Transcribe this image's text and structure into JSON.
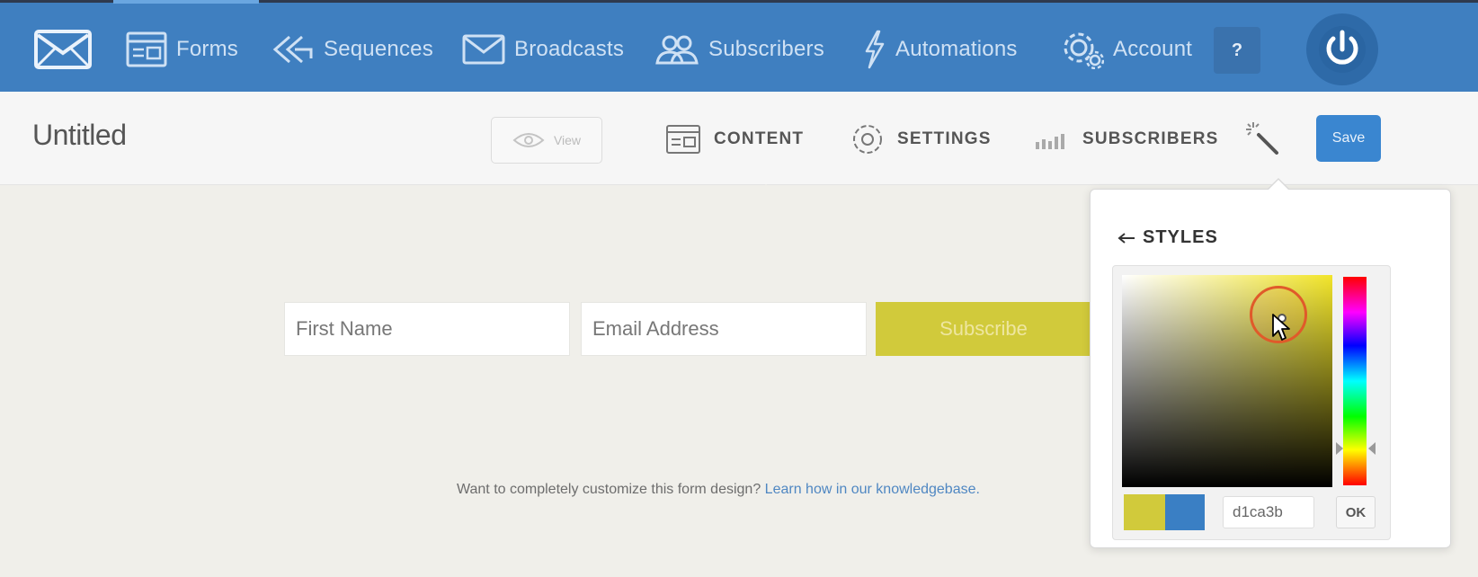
{
  "nav": {
    "items": [
      {
        "label": "Forms",
        "icon": "forms-icon"
      },
      {
        "label": "Sequences",
        "icon": "sequences-icon"
      },
      {
        "label": "Broadcasts",
        "icon": "envelope-icon"
      },
      {
        "label": "Subscribers",
        "icon": "users-icon"
      },
      {
        "label": "Automations",
        "icon": "lightning-icon"
      },
      {
        "label": "Account",
        "icon": "gear-icon"
      }
    ],
    "help_label": "?",
    "brand_color": "#3f7fc0"
  },
  "subbar": {
    "title": "Untitled",
    "view_label": "View",
    "tabs": [
      {
        "label": "CONTENT",
        "icon": "content-icon",
        "selected": true
      },
      {
        "label": "SETTINGS",
        "icon": "gear-icon",
        "selected": false
      },
      {
        "label": "SUBSCRIBERS",
        "icon": "bar-chart-icon",
        "selected": false
      }
    ],
    "save_label": "Save"
  },
  "form": {
    "first_name_placeholder": "First Name",
    "email_placeholder": "Email Address",
    "subscribe_label": "Subscribe",
    "button_color": "#d1ca3b",
    "help_text": "Want to completely customize this form design?",
    "help_link": "Learn how in our knowledgebase."
  },
  "styles_popover": {
    "title": "STYLES",
    "back_icon": "arrow-left-icon",
    "hex_value": "d1ca3b",
    "new_color": "#d1ca3b",
    "old_color": "#3a7fc4",
    "ok_label": "OK"
  }
}
